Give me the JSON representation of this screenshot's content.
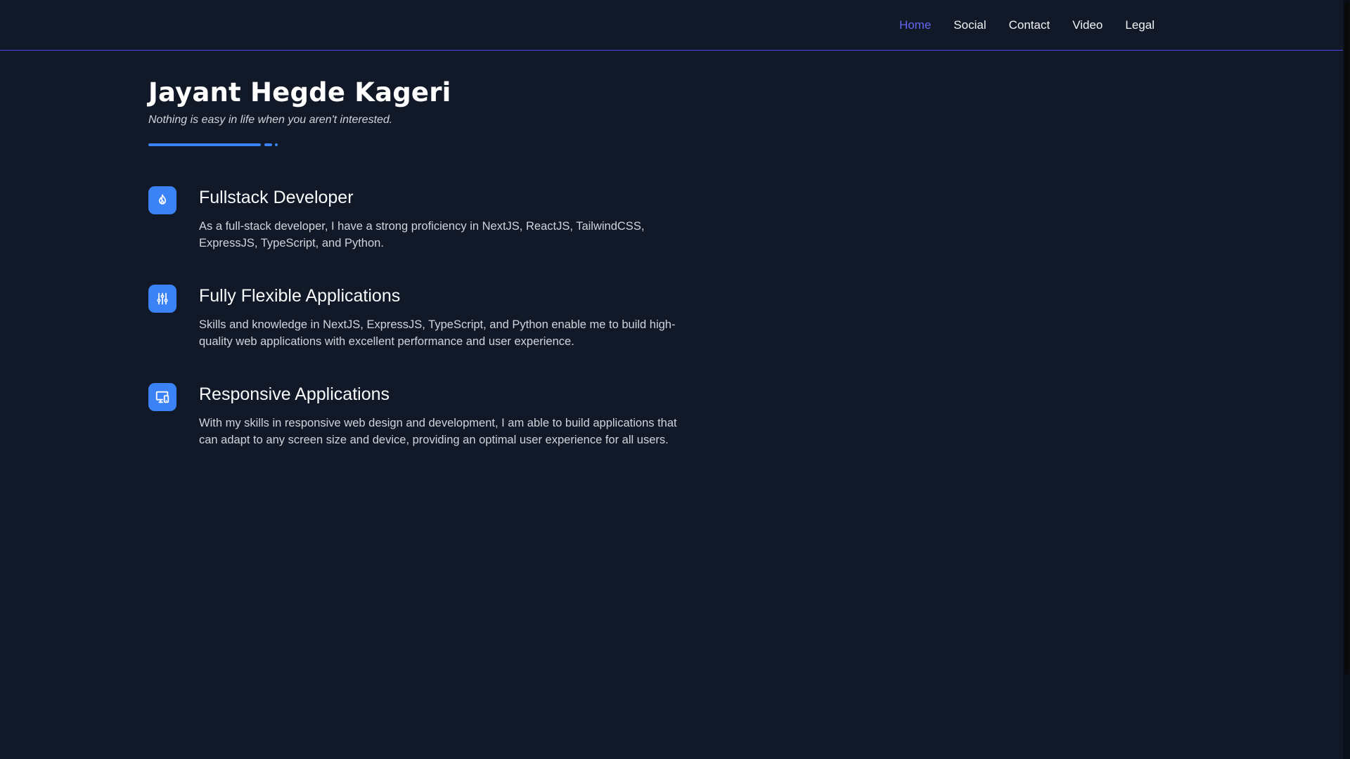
{
  "nav": {
    "items": [
      {
        "label": "Home",
        "active": true
      },
      {
        "label": "Social",
        "active": false
      },
      {
        "label": "Contact",
        "active": false
      },
      {
        "label": "Video",
        "active": false
      },
      {
        "label": "Legal",
        "active": false
      }
    ]
  },
  "hero": {
    "name": "Jayant Hegde Kageri",
    "tagline": "Nothing is easy in life when you aren't interested."
  },
  "features": [
    {
      "icon": "flame-icon",
      "title": "Fullstack Developer",
      "description": "As a full-stack developer, I have a strong proficiency in NextJS, ReactJS, TailwindCSS, ExpressJS, TypeScript, and Python."
    },
    {
      "icon": "sliders-icon",
      "title": "Fully Flexible Applications",
      "description": "Skills and knowledge in NextJS, ExpressJS, TypeScript, and Python enable me to build high-quality web applications with excellent performance and user experience."
    },
    {
      "icon": "devices-icon",
      "title": "Responsive Applications",
      "description": "With my skills in responsive web design and development, I am able to build applications that can adapt to any screen size and device, providing an optimal user experience for all users."
    }
  ],
  "colors": {
    "background": "#111827",
    "accent": "#3b82f6",
    "nav_active": "#6366f1",
    "header_border": "#4f46e5"
  }
}
